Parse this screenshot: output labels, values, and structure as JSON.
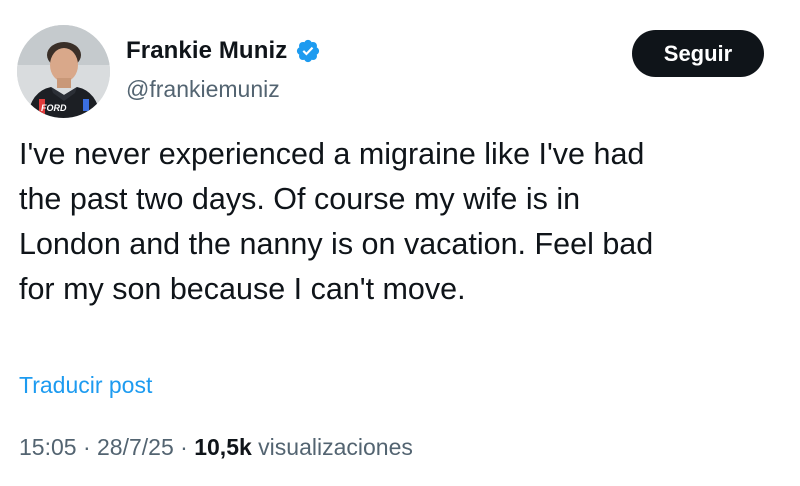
{
  "author": {
    "display_name": "Frankie Muniz",
    "handle": "@frankiemuniz",
    "verified_icon": "verified-badge-icon",
    "avatar_logo_text": "FORD"
  },
  "follow_button": {
    "label": "Seguir"
  },
  "tweet": {
    "text_lines": [
      "I've never experienced a migraine like I've had",
      "the past two days. Of course my wife is in",
      "London and the nanny is on vacation. Feel bad",
      "for my son because I can't move."
    ]
  },
  "translate": {
    "label": "Traducir post"
  },
  "meta": {
    "time": "15:05",
    "separator": "·",
    "date": "28/7/25",
    "views_count": "10,5k",
    "views_label": "visualizaciones"
  },
  "colors": {
    "text_primary": "#0f1419",
    "text_secondary": "#536471",
    "link": "#1d9bf0",
    "verified": "#1d9bf0",
    "button_bg": "#0f1419",
    "button_text": "#ffffff"
  }
}
